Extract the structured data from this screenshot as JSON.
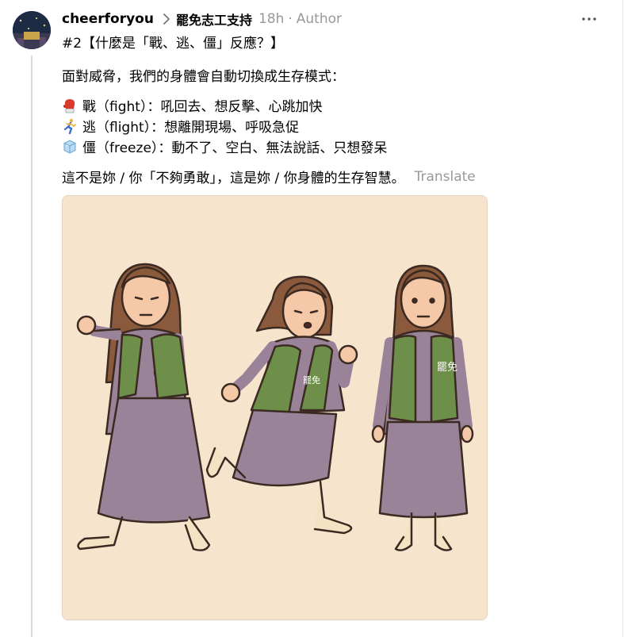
{
  "post": {
    "username": "cheerforyou",
    "topic": "罷免志工支持",
    "time": "18h",
    "role": "Author",
    "separator": "·",
    "title": "#2【什麼是「戰、逃、僵」反應？】",
    "intro": "面對威脅，我們的身體會自動切換成生存模式：",
    "responses": [
      {
        "icon": "boxing-glove-icon",
        "text": "戰（fight）：吼回去、想反擊、心跳加快"
      },
      {
        "icon": "running-person-icon",
        "text": "逃（flight）：想離開現場、呼吸急促"
      },
      {
        "icon": "ice-cube-icon",
        "text": "僵（freeze）：動不了、空白、無法說話、只想發呆"
      }
    ],
    "conclusion": "這不是妳 / 你「不夠勇敢」，這是妳 / 你身體的生存智慧。",
    "translate_label": "Translate",
    "vest_text": "罷免"
  },
  "colors": {
    "illustration_bg": "#f7e4cd",
    "vest_green": "#6e8f49",
    "dress_purple": "#9a8399",
    "hair_brown": "#8b5a3c",
    "muted_text": "#999999"
  }
}
